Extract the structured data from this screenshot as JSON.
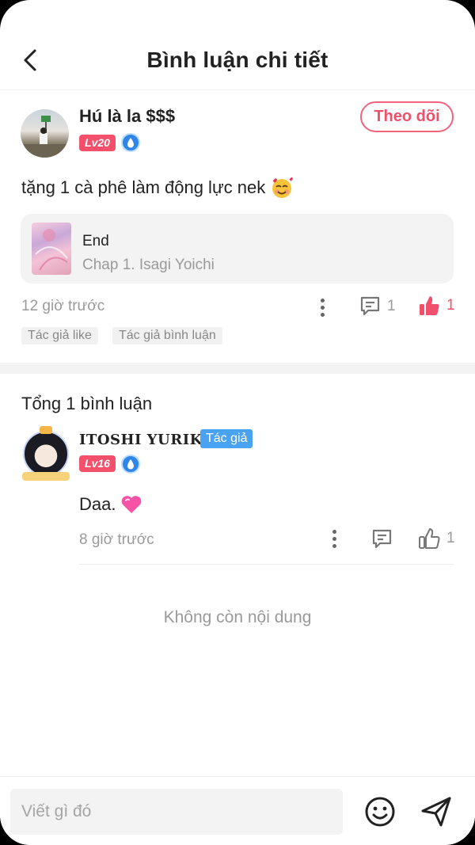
{
  "header": {
    "title": "Bình luận chi tiết"
  },
  "post": {
    "username": "Hú là la $$$",
    "level": "Lv20",
    "follow_label": "Theo dõi",
    "text": "tặng 1 cà phê làm động lực nek",
    "reference": {
      "title": "End",
      "subtitle": "Chap 1. Isagi Yoichi"
    },
    "time": "12 giờ trước",
    "comment_count": "1",
    "like_count": "1",
    "tags": [
      "Tác giả like",
      "Tác giả bình luận"
    ]
  },
  "comments_section": {
    "total_label": "Tổng 1 bình luận",
    "empty_label": "Không còn nội dung"
  },
  "comments": [
    {
      "username": "ITOSHI YURIKO",
      "author_tag": "Tác giả",
      "level": "Lv16",
      "text": "Daa.",
      "time": "8 giờ trước",
      "like_count": "1"
    }
  ],
  "composer": {
    "placeholder": "Viết gì đó"
  },
  "colors": {
    "accent": "#f0506b",
    "author_tag": "#4aa3f2",
    "vip_badge": "#2f86e6"
  }
}
